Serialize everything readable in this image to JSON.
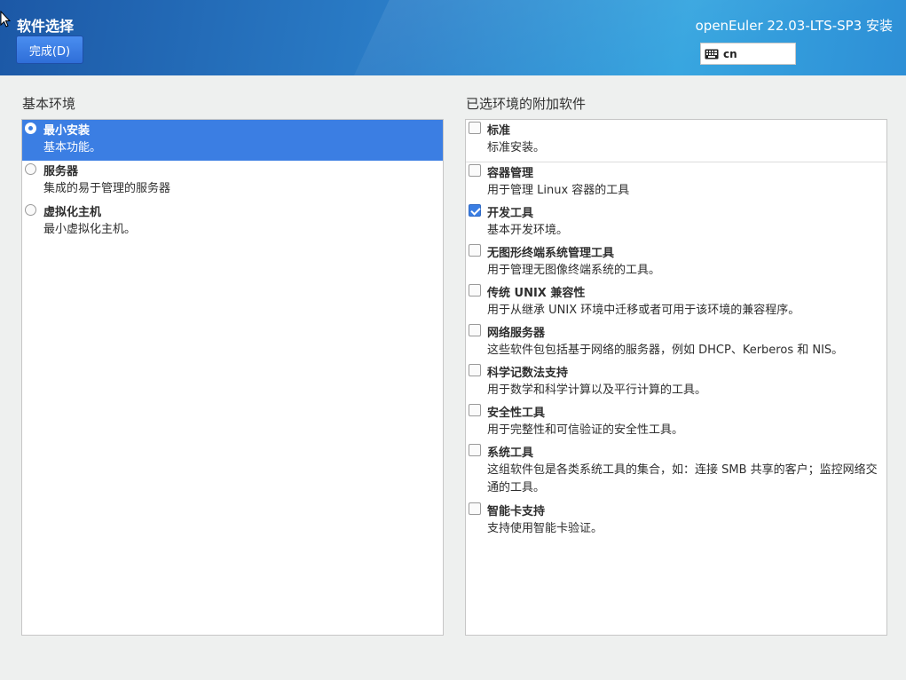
{
  "header": {
    "title": "软件选择",
    "done_button": "完成(D)",
    "product": "openEuler 22.03-LTS-SP3 安装",
    "keyboard_layout": "cn"
  },
  "base_env": {
    "heading": "基本环境",
    "items": [
      {
        "name": "最小安装",
        "desc": "基本功能。",
        "selected": true
      },
      {
        "name": "服务器",
        "desc": "集成的易于管理的服务器",
        "selected": false
      },
      {
        "name": "虚拟化主机",
        "desc": "最小虚拟化主机。",
        "selected": false
      }
    ]
  },
  "addons": {
    "heading": "已选环境的附加软件",
    "items": [
      {
        "name": "标准",
        "desc": "标准安装。",
        "checked": false
      },
      {
        "name": "容器管理",
        "desc": "用于管理 Linux 容器的工具",
        "checked": false
      },
      {
        "name": "开发工具",
        "desc": "基本开发环境。",
        "checked": true
      },
      {
        "name": "无图形终端系统管理工具",
        "desc": "用于管理无图像终端系统的工具。",
        "checked": false
      },
      {
        "name": "传统 UNIX 兼容性",
        "desc": "用于从继承 UNIX 环境中迁移或者可用于该环境的兼容程序。",
        "checked": false
      },
      {
        "name": "网络服务器",
        "desc": "这些软件包包括基于网络的服务器，例如 DHCP、Kerberos 和 NIS。",
        "checked": false
      },
      {
        "name": "科学记数法支持",
        "desc": "用于数学和科学计算以及平行计算的工具。",
        "checked": false
      },
      {
        "name": "安全性工具",
        "desc": "用于完整性和可信验证的安全性工具。",
        "checked": false
      },
      {
        "name": "系统工具",
        "desc": "这组软件包是各类系统工具的集合，如：连接 SMB 共享的客户；监控网络交通的工具。",
        "checked": false
      },
      {
        "name": "智能卡支持",
        "desc": "支持使用智能卡验证。",
        "checked": false
      }
    ]
  },
  "colors": {
    "accent": "#3b7ee3",
    "header_start": "#1c58a6",
    "header_end": "#38a6e0"
  }
}
